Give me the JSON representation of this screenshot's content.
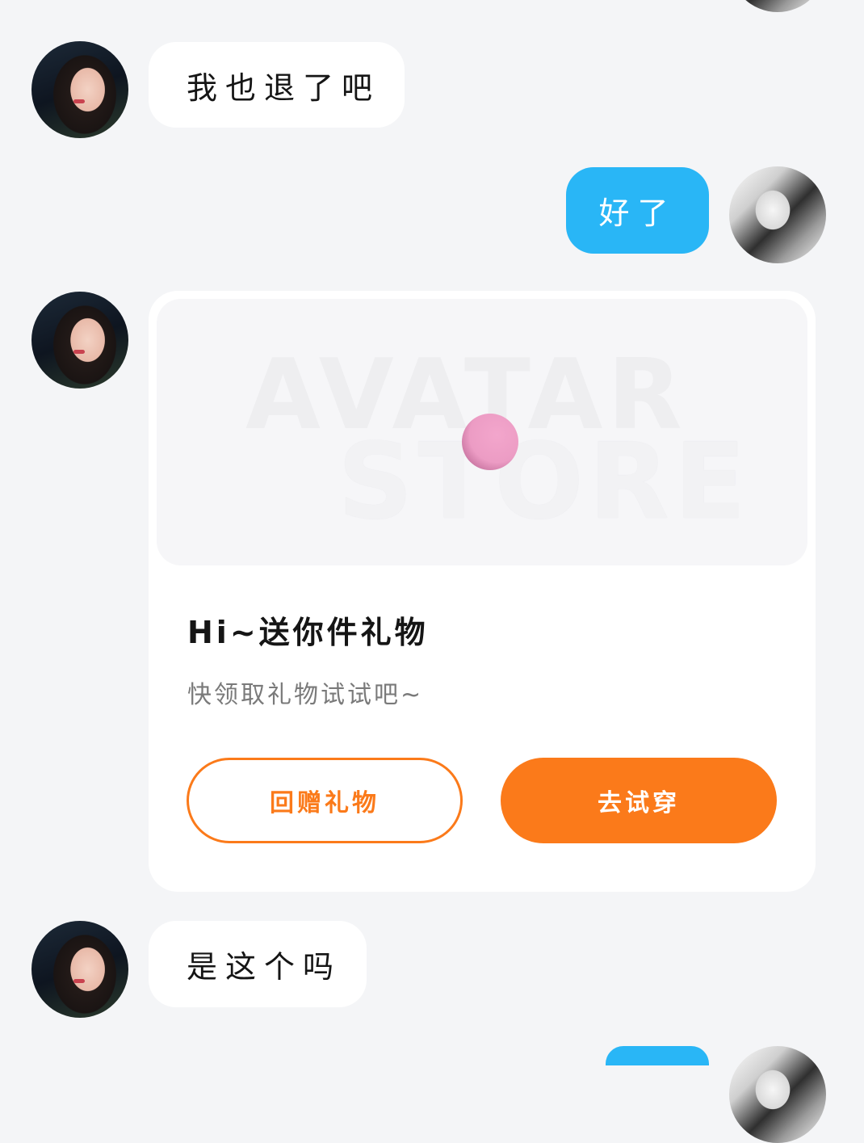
{
  "messages": [
    {
      "side": "in",
      "text": "我也退了吧"
    },
    {
      "side": "out",
      "text": "好了"
    },
    {
      "side": "in",
      "text": "是这个吗"
    }
  ],
  "gift_card": {
    "image_watermark_line1": "AVATAR",
    "image_watermark_line2": "STORE",
    "title": "Hi~送你件礼物",
    "subtitle": "快领取礼物试试吧~",
    "secondary_button": "回赠礼物",
    "primary_button": "去试穿"
  },
  "colors": {
    "background": "#f4f5f7",
    "outgoing_bubble": "#29b6f6",
    "accent_orange": "#fb7a1a"
  }
}
